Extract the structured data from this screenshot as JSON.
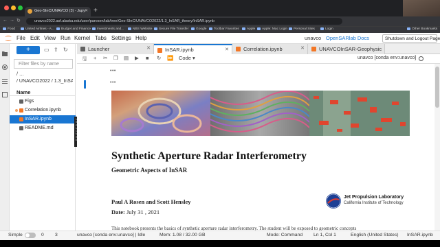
{
  "browser": {
    "tab_title": "Geo-SInC/UNAVCO (3) - Jupy",
    "url": "unavco2022.asf.alaska.edu/user/parosen/lab/tree/Geo-SInC/UNAVCO2022/1.3_InSAR_theory/InSAR.ipynb",
    "bookmarks": [
      "Food",
      "United Airlines - A...",
      "Budget and Finance",
      "Investments and...",
      "NBS Website",
      "Secure File Transfer",
      "Google",
      "Toolbar Favorites",
      "Apple",
      "Apple: Mac Login",
      "Personal Sites",
      "Login",
      "Other Bookmarks"
    ]
  },
  "menubar": {
    "items": [
      "File",
      "Edit",
      "View",
      "Run",
      "Kernel",
      "Tabs",
      "Settings",
      "Help"
    ],
    "server_name": "unavco",
    "docs_link": "OpenSARlab Docs",
    "shutdown_label": "Shutdown and Logout Page"
  },
  "filebrowser": {
    "filter_placeholder": "Filter files by name",
    "crumb_line1": "/  …",
    "crumb_line2": "/ UNAVCO2022 / 1.3_InSA",
    "name_header": "Name",
    "files": [
      {
        "name": "Figs",
        "type": "folder"
      },
      {
        "name": "Correlation.ipynb",
        "type": "notebook"
      },
      {
        "name": "InSAR.ipynb",
        "type": "notebook"
      },
      {
        "name": "README.md",
        "type": "markdown"
      }
    ],
    "tooltip": [
      "Name: Correlation.ipynb",
      "Size: 98.8 KB",
      "Path: Geo-SInC/",
      "UNAVCO2022/1.3_InSAR_theory",
      "Created: 2022-08-22 11:49:54",
      "Modified: 2022-08-22 11:49:54",
      "Writable: true",
      "kernel: unavco [conda env:unavco]"
    ]
  },
  "doc_tabs": [
    {
      "label": "Launcher"
    },
    {
      "label": "InSAR.ipynb"
    },
    {
      "label": "Correlation.ipynb"
    },
    {
      "label": "UNAVCOInSAR-Geophysic"
    }
  ],
  "toolbar": {
    "cell_type": "Code",
    "kernel_name": "unavco [conda env:unavco]"
  },
  "notebook": {
    "ellipsis": "•••",
    "title": "Synthetic Aperture Radar Interferometry",
    "subtitle": "Geometric Aspects of InSAR",
    "authors": "Paul A Rosen and Scott Hensley",
    "date_label": "Date:",
    "date_value": "July 31 , 2021",
    "body_start": "This notebook presents the basics of synthetic aperture radar interferometry. The student will be exposed to geometric concepts",
    "jpl_name": "Jet Propulsion Laboratory",
    "jpl_sub": "California Institute of Technology"
  },
  "status": {
    "mode": "Simple",
    "count1": "0",
    "count2": "3",
    "kernel": "unavco [conda env:unavco] | Idle",
    "mem": "Mem: 1.08 / 32.00 GB",
    "edit_mode": "Mode: Command",
    "position": "Ln 1, Col 1",
    "language": "English (United States)",
    "filename": "InSAR.ipynb"
  },
  "colors": {
    "accent": "#1976d2",
    "notebook_dot": "#f4a261"
  }
}
